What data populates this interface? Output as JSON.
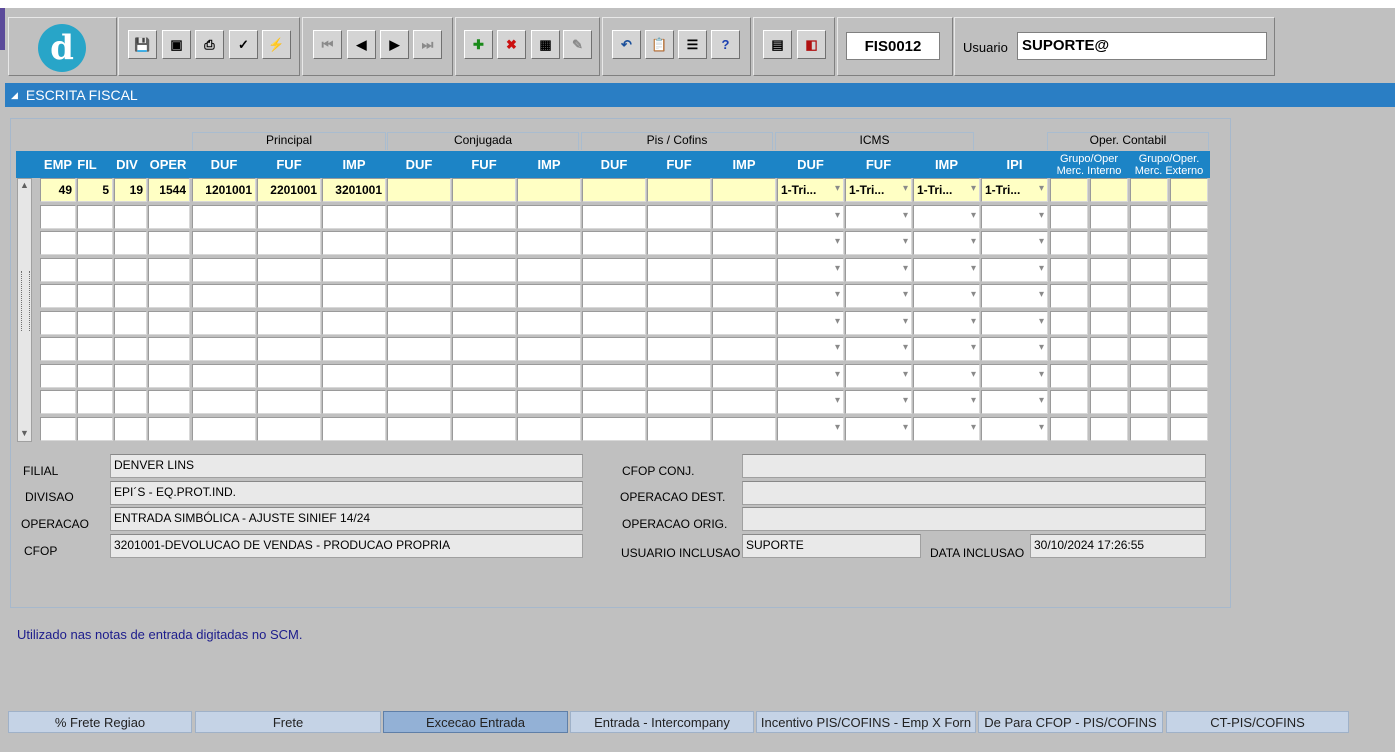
{
  "toolbar": {
    "logo_letter": "d",
    "form_code": "FIS0012",
    "user_label": "Usuario",
    "user_value": "SUPORTE@",
    "help_glyph": "?"
  },
  "window": {
    "title": "ESCRITA FISCAL"
  },
  "groups": {
    "principal": "Principal",
    "conjugada": "Conjugada",
    "pis_cofins": "Pis / Cofins",
    "icms": "ICMS",
    "oper_contabil": "Oper. Contabil"
  },
  "headers": {
    "emp": "EMP",
    "fil": "FIL",
    "div": "DIV",
    "oper": "OPER",
    "duf": "DUF",
    "fuf": "FUF",
    "imp": "IMP",
    "ipi": "IPI",
    "grupo_interno": "Grupo/Oper Merc. Interno",
    "grupo_externo": "Grupo/Oper. Merc. Externo"
  },
  "rows": [
    {
      "emp": "49",
      "fil": "5",
      "div": "19",
      "oper": "1544",
      "p_duf": "1201001",
      "p_fuf": "2201001",
      "p_imp": "3201001",
      "c_duf": "",
      "c_fuf": "",
      "c_imp": "",
      "pc_duf": "",
      "pc_fuf": "",
      "pc_imp": "",
      "icms_duf": "1-Tri...",
      "icms_fuf": "1-Tri...",
      "icms_imp": "1-Tri...",
      "ipi": "1-Tri...",
      "gi1": "",
      "gi2": "",
      "ge1": "",
      "ge2": ""
    }
  ],
  "details": {
    "filial_label": "FILIAL",
    "filial_value": "DENVER LINS",
    "divisao_label": "DIVISAO",
    "divisao_value": "EPI´S - EQ.PROT.IND.",
    "operacao_label": "OPERACAO",
    "operacao_value": "ENTRADA SIMBÓLICA - AJUSTE SINIEF 14/24",
    "cfop_label": "CFOP",
    "cfop_value": "3201001-DEVOLUCAO DE VENDAS - PRODUCAO PROPRIA",
    "cfop_conj_label": "CFOP CONJ.",
    "cfop_conj_value": "",
    "oper_dest_label": "OPERACAO DEST.",
    "oper_dest_value": "",
    "oper_orig_label": "OPERACAO ORIG.",
    "oper_orig_value": "",
    "usuario_label": "USUARIO INCLUSAO",
    "usuario_value": "SUPORTE",
    "data_label": "DATA INCLUSAO",
    "data_value": "30/10/2024 17:26:55"
  },
  "hint": "Utilizado nas notas de entrada digitadas no SCM.",
  "tabs": [
    "% Frete Regiao",
    "Frete",
    "Excecao Entrada",
    "Entrada - Intercompany",
    "Incentivo PIS/COFINS - Emp X Forn",
    "De Para CFOP - PIS/COFINS",
    "CT-PIS/COFINS"
  ],
  "active_tab": "Excecao Entrada"
}
